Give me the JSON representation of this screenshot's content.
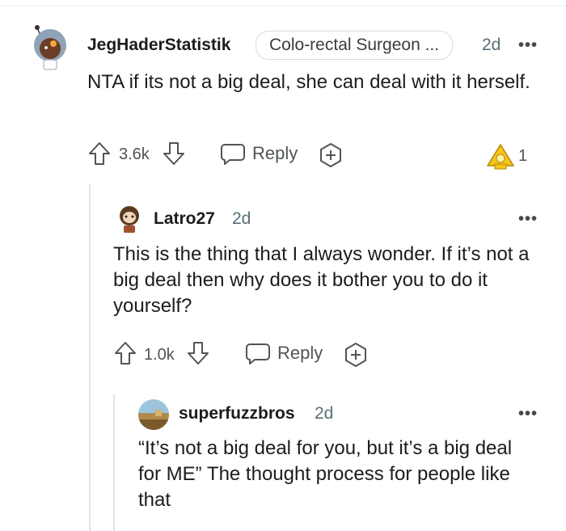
{
  "comments": [
    {
      "username": "JegHaderStatistik",
      "flair": "Colo-rectal Surgeon ...",
      "age": "2d",
      "more": "•••",
      "body": "NTA if its not a big deal, she can deal with it herself.",
      "votes": "3.6k",
      "reply_label": "Reply",
      "award_count": "1"
    },
    {
      "username": "Latro27",
      "age": "2d",
      "more": "•••",
      "body": "This is the thing that I always wonder. If it’s not a big deal then why does it bother you to do it yourself?",
      "votes": "1.0k",
      "reply_label": "Reply"
    },
    {
      "username": "superfuzzbros",
      "age": "2d",
      "more": "•••",
      "body": "“It’s not a big deal for you, but it’s a big deal for ME” The thought process for people like that"
    }
  ],
  "icons": {
    "upvote": "arrow-up-outline",
    "downvote": "arrow-down-outline",
    "reply": "speech-bubble",
    "award": "plus-circle",
    "award_received": "gold-award-badge"
  },
  "colors": {
    "meta_gray": "#576f76",
    "thread_line": "#e3e6e8",
    "award_gold": "#f5c518"
  }
}
